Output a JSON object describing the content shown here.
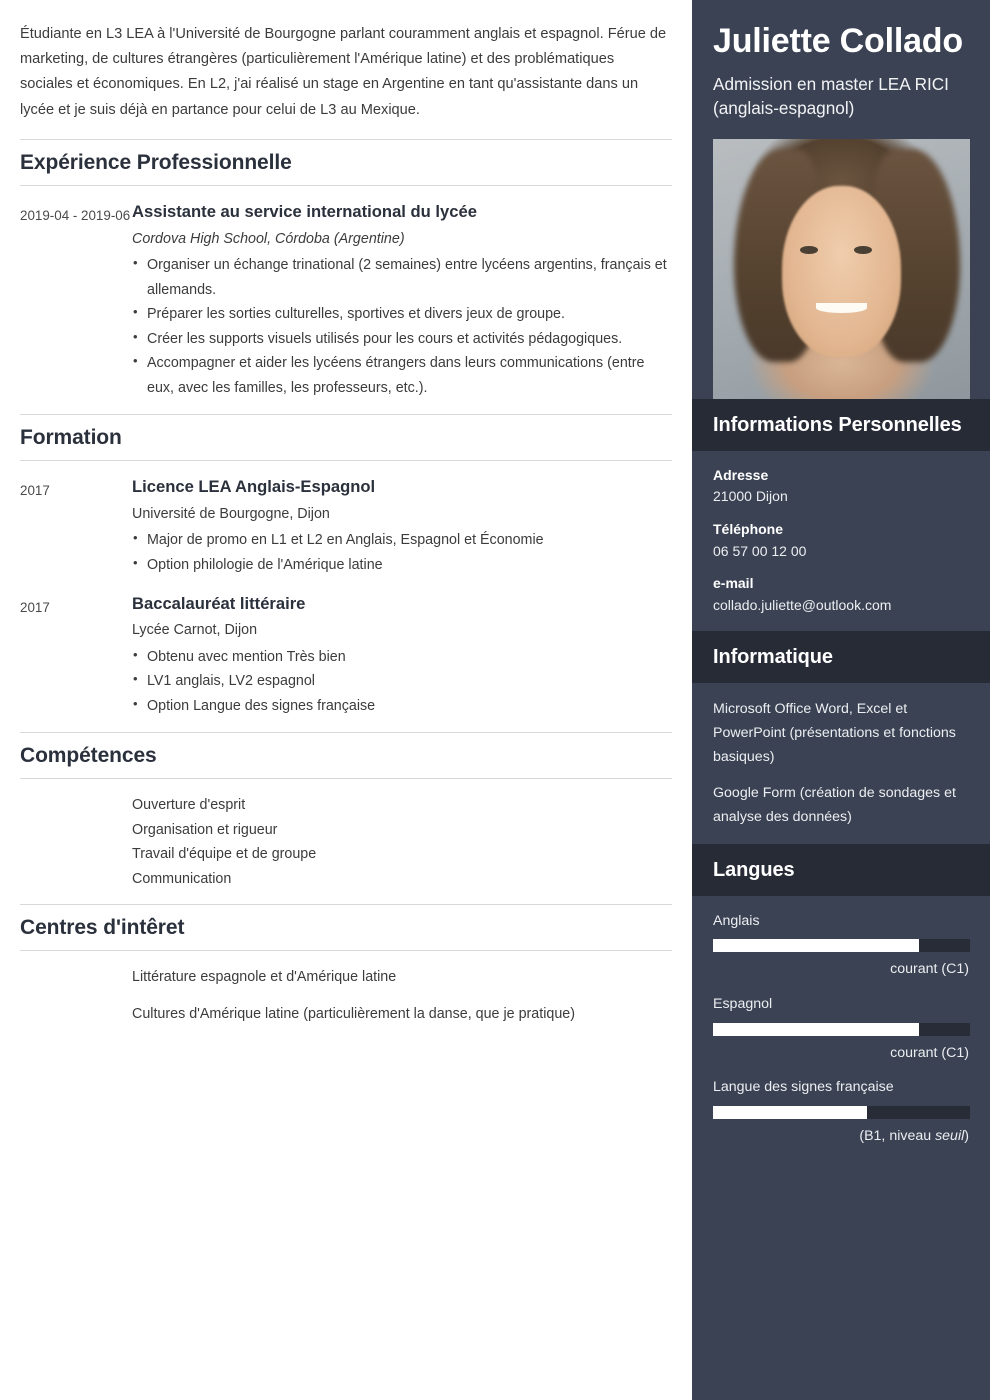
{
  "colors": {
    "sidebar_bg": "#3b4253",
    "sidebar_header_bg": "#262b36",
    "page_bg": "#ffffff",
    "heading_text": "#2b313c",
    "body_text": "#3c3c3c",
    "bar_fill": "#ffffff",
    "bar_track": "#272c37",
    "rule": "#d8d8d8"
  },
  "main": {
    "summary": "Étudiante en L3 LEA à l'Université de Bourgogne parlant couramment anglais et espagnol. Férue de marketing, de cultures étrangères (particulièrement l'Amérique latine) et des problématiques sociales et économiques. En L2, j'ai réalisé un stage en Argentine en tant qu'assistante dans un lycée et je suis déjà en partance pour celui de L3 au Mexique.",
    "sections": [
      {
        "title": "Expérience Professionnelle",
        "entries": [
          {
            "date": "2019-04 - 2019-06",
            "title": "Assistante au service international du lycée",
            "subtitle": "Cordova High School, Córdoba (Argentine)",
            "bullets": [
              "Organiser un échange trinational (2 semaines) entre lycéens argentins, français et allemands.",
              "Préparer les sorties culturelles, sportives et divers jeux de groupe.",
              "Créer les supports visuels utilisés pour les cours et activités pédagogiques.",
              "Accompagner et aider les lycéens étrangers dans leurs communications (entre eux, avec les familles, les professeurs, etc.)."
            ]
          }
        ]
      },
      {
        "title": "Formation",
        "entries": [
          {
            "date": "2017",
            "title": "Licence LEA Anglais-Espagnol",
            "subtitle": "Université de Bourgogne, Dijon",
            "bullets": [
              "Major de promo en L1 et L2 en Anglais, Espagnol et Économie",
              "Option philologie de l'Amérique latine"
            ]
          },
          {
            "date": "2017",
            "title": "Baccalauréat littéraire",
            "subtitle": "Lycée Carnot, Dijon",
            "bullets": [
              "Obtenu avec mention Très bien",
              "LV1 anglais, LV2 espagnol",
              "Option Langue des signes française"
            ]
          }
        ]
      },
      {
        "title": "Compétences",
        "items": [
          "Ouverture d'esprit",
          "Organisation et rigueur",
          "Travail d'équipe et de groupe",
          "Communication"
        ]
      },
      {
        "title": "Centres d'intêret",
        "items": [
          "Littérature espagnole et d'Amérique latine",
          "Cultures d'Amérique latine (particulièrement la danse, que je pratique)"
        ]
      }
    ]
  },
  "sidebar": {
    "name": "Juliette Collado",
    "tagline": "Admission en master LEA RICI (anglais-espagnol)",
    "photo_alt": "portrait-photo",
    "personal": {
      "title": "Informations Personnelles",
      "fields": [
        {
          "label": "Adresse",
          "value": "21000 Dijon"
        },
        {
          "label": "Téléphone",
          "value": "06 57 00 12 00"
        },
        {
          "label": "e-mail",
          "value": "collado.juliette@outlook.com"
        }
      ]
    },
    "software": {
      "title": "Informatique",
      "items": [
        "Microsoft Office Word, Excel et PowerPoint (présentations et fonctions basiques)",
        "Google Form (création de sondages et analyse des données)"
      ]
    },
    "languages": {
      "title": "Langues",
      "items": [
        {
          "name": "Anglais",
          "level_text": "courant (C1)",
          "level_pre": "courant (C1)",
          "level_em": "",
          "level_post": "",
          "percent": 80
        },
        {
          "name": "Espagnol",
          "level_text": "courant (C1)",
          "level_pre": "courant (C1)",
          "level_em": "",
          "level_post": "",
          "percent": 80
        },
        {
          "name": "Langue des signes française",
          "level_text": "(B1, niveau seuil)",
          "level_pre": "(B1, niveau ",
          "level_em": "seuil",
          "level_post": ")",
          "percent": 60
        }
      ]
    }
  }
}
